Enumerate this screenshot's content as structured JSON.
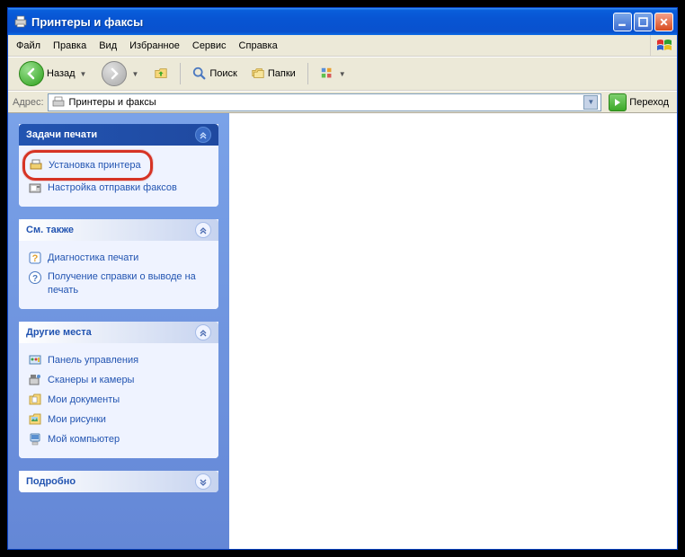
{
  "window": {
    "title": "Принтеры и факсы"
  },
  "menu": {
    "file": "Файл",
    "edit": "Правка",
    "view": "Вид",
    "favorites": "Избранное",
    "tools": "Сервис",
    "help": "Справка"
  },
  "toolbar": {
    "back": "Назад",
    "search": "Поиск",
    "folders": "Папки"
  },
  "address": {
    "label": "Адрес:",
    "value": "Принтеры и факсы",
    "go": "Переход"
  },
  "side": {
    "tasks": {
      "header": "Задачи печати",
      "install": "Установка принтера",
      "fax": "Настройка отправки факсов"
    },
    "see_also": {
      "header": "См. также",
      "diag": "Диагностика печати",
      "help": "Получение справки о выводе на печать"
    },
    "places": {
      "header": "Другие места",
      "cp": "Панель управления",
      "scan": "Сканеры и камеры",
      "docs": "Мои документы",
      "pics": "Мои рисунки",
      "pc": "Мой компьютер"
    },
    "details": {
      "header": "Подробно"
    }
  }
}
